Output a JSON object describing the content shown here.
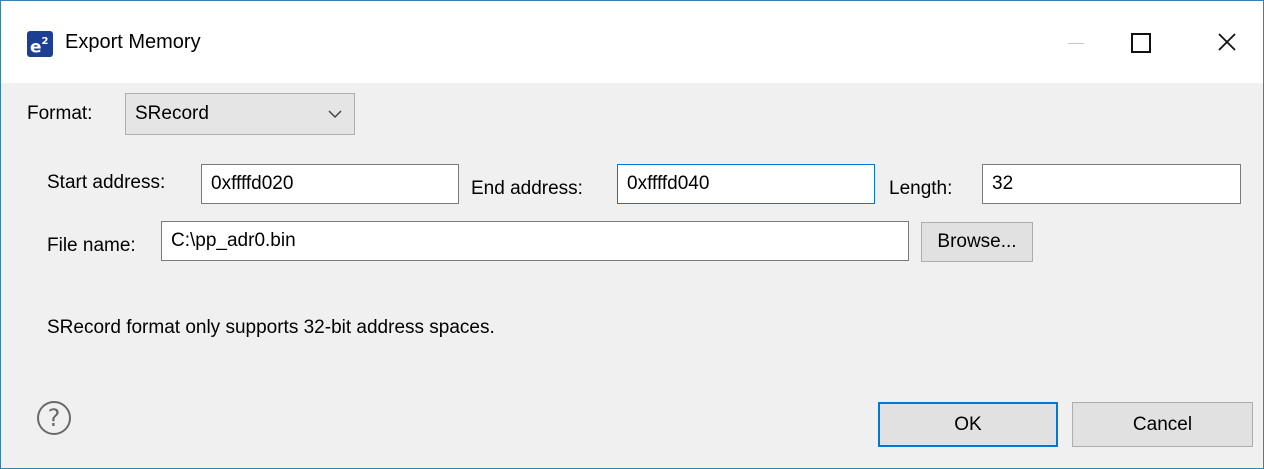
{
  "window": {
    "title": "Export Memory",
    "app_icon_text": "e",
    "app_icon_sup": "2",
    "accent_color": "#0078d7"
  },
  "format": {
    "label": "Format:",
    "selected": "SRecord"
  },
  "address": {
    "start_label": "Start address:",
    "start_value": "0xffffd020",
    "end_label": "End address:",
    "end_value": "0xffffd040",
    "length_label": "Length:",
    "length_value": "32"
  },
  "file": {
    "label": "File name:",
    "value": "C:\\pp_adr0.bin",
    "browse_label": "Browse..."
  },
  "message": "SRecord format only supports 32-bit address spaces.",
  "footer": {
    "help_icon": "?",
    "ok_label": "OK",
    "cancel_label": "Cancel"
  }
}
